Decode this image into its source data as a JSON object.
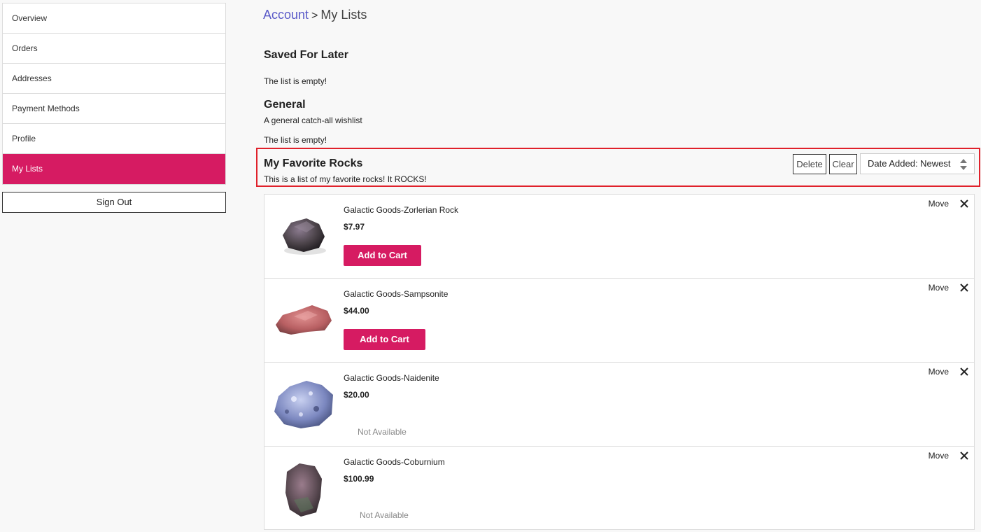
{
  "sidebar": {
    "items": [
      {
        "label": "Overview"
      },
      {
        "label": "Orders"
      },
      {
        "label": "Addresses"
      },
      {
        "label": "Payment Methods"
      },
      {
        "label": "Profile"
      },
      {
        "label": "My Lists"
      }
    ],
    "sign_out": "Sign Out"
  },
  "breadcrumb": {
    "parent": "Account",
    "separator": ">",
    "current": "My Lists"
  },
  "lists": {
    "saved": {
      "title": "Saved For Later",
      "empty": "The list is empty!"
    },
    "general": {
      "title": "General",
      "description": "A general catch-all wishlist",
      "empty": "The list is empty!"
    },
    "favorites": {
      "title": "My Favorite Rocks",
      "description": "This is a list of my favorite rocks! It ROCKS!",
      "delete_label": "Delete",
      "clear_label": "Clear",
      "sort_value": "Date Added: Newest",
      "items": [
        {
          "name": "Galactic Goods-Zorlerian Rock",
          "price": "$7.97",
          "action": "Add to Cart",
          "move": "Move",
          "icon": "close-icon"
        },
        {
          "name": "Galactic Goods-Sampsonite",
          "price": "$44.00",
          "action": "Add to Cart",
          "move": "Move",
          "icon": "close-icon"
        },
        {
          "name": "Galactic Goods-Naidenite",
          "price": "$20.00",
          "action": "Not Available",
          "move": "Move",
          "icon": "close-icon"
        },
        {
          "name": "Galactic Goods-Coburnium",
          "price": "$100.99",
          "action": "Not Available",
          "move": "Move",
          "icon": "close-icon"
        }
      ]
    }
  },
  "colors": {
    "accent": "#d61b62",
    "link": "#5a5ac8",
    "highlight_border": "#e0212b"
  }
}
